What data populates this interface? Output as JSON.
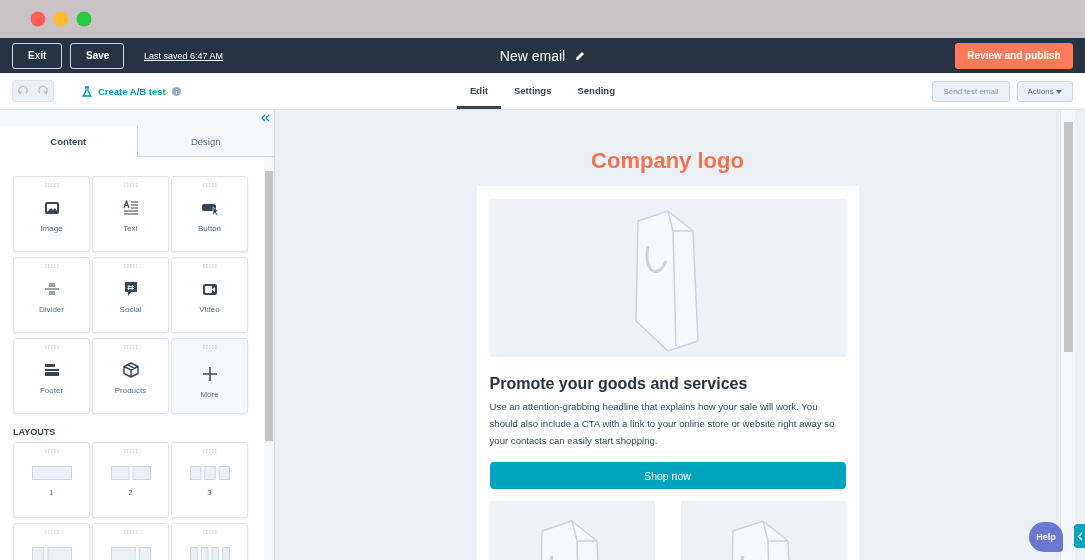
{
  "header": {
    "exit": "Exit",
    "save": "Save",
    "last_saved": "Last saved 6:47 AM",
    "title": "New email",
    "publish": "Review and publish"
  },
  "toolbar": {
    "ab_test": "Create A/B test",
    "tabs": [
      {
        "label": "Edit",
        "selected": true
      },
      {
        "label": "Settings",
        "selected": false
      },
      {
        "label": "Sending",
        "selected": false
      }
    ],
    "send_test": "Send test email",
    "actions": "Actions"
  },
  "sidebar": {
    "tabs": [
      {
        "label": "Content",
        "selected": true
      },
      {
        "label": "Design",
        "selected": false
      }
    ],
    "modules": [
      {
        "label": "Image",
        "kind": "image"
      },
      {
        "label": "Text",
        "kind": "text"
      },
      {
        "label": "Button",
        "kind": "button"
      },
      {
        "label": "Divider",
        "kind": "divider"
      },
      {
        "label": "Social",
        "kind": "social"
      },
      {
        "label": "Video",
        "kind": "video"
      },
      {
        "label": "Footer",
        "kind": "footer"
      },
      {
        "label": "Products",
        "kind": "products"
      },
      {
        "label": "More",
        "kind": "more"
      }
    ],
    "layouts_heading": "LAYOUTS",
    "layouts": [
      {
        "label": "1",
        "kind": "one"
      },
      {
        "label": "2",
        "kind": "two"
      },
      {
        "label": "3",
        "kind": "three"
      },
      {
        "kind": "one-two"
      },
      {
        "kind": "two-one"
      },
      {
        "kind": "four"
      }
    ]
  },
  "email": {
    "logo": "Company logo",
    "headline": "Promote your goods and services",
    "body": "Use an attention-grabbing headline that explains how your sale will work. You should also include a CTA with a link to your online store or website right away so your contacts can easily start shopping.",
    "cta": "Shop now"
  },
  "help": "Help"
}
